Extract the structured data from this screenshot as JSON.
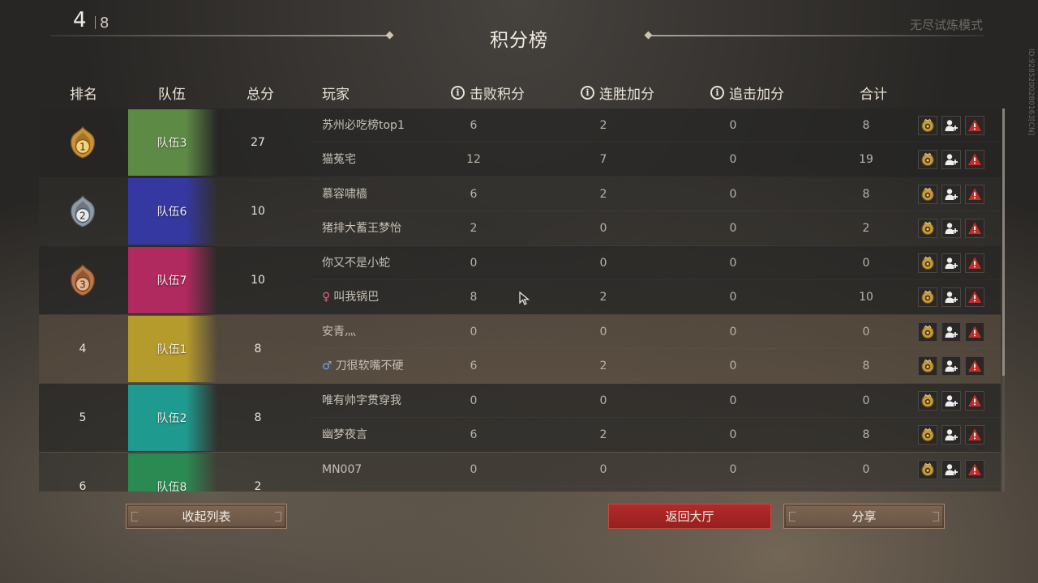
{
  "header": {
    "round_current": "4",
    "round_total": "8",
    "title": "积分榜",
    "mode": "无尽试炼模式",
    "side_id": "ID:9285200280163[CN]"
  },
  "columns": {
    "rank": "排名",
    "team": "队伍",
    "total": "总分",
    "player": "玩家",
    "defeat_points": "击败积分",
    "streak_bonus": "连胜加分",
    "chase_bonus": "追击加分",
    "sum": "合计"
  },
  "teams": [
    {
      "rank": "1",
      "medal": "gold",
      "name": "队伍3",
      "total": "27",
      "color": "#5d8a45",
      "style": "odd",
      "players": [
        {
          "name": "苏州必吃榜top1",
          "gender": "",
          "defeat": "6",
          "streak": "2",
          "chase": "0",
          "sum": "8"
        },
        {
          "name": "猫菟宅",
          "gender": "",
          "defeat": "12",
          "streak": "7",
          "chase": "0",
          "sum": "19"
        }
      ]
    },
    {
      "rank": "2",
      "medal": "silver",
      "name": "队伍6",
      "total": "10",
      "color": "#3538a0",
      "style": "even",
      "players": [
        {
          "name": "慕容啸樯",
          "gender": "",
          "defeat": "6",
          "streak": "2",
          "chase": "0",
          "sum": "8"
        },
        {
          "name": "猪排大蓄王梦怡",
          "gender": "",
          "defeat": "2",
          "streak": "0",
          "chase": "0",
          "sum": "2"
        }
      ]
    },
    {
      "rank": "3",
      "medal": "bronze",
      "name": "队伍7",
      "total": "10",
      "color": "#b0295f",
      "style": "odd",
      "players": [
        {
          "name": "你又不是小蛇",
          "gender": "",
          "defeat": "0",
          "streak": "0",
          "chase": "0",
          "sum": "0"
        },
        {
          "name": "叫我锅巴",
          "gender": "♀",
          "defeat": "8",
          "streak": "2",
          "chase": "0",
          "sum": "10"
        }
      ]
    },
    {
      "rank": "4",
      "medal": "",
      "name": "队伍1",
      "total": "8",
      "color": "#b59a2c",
      "style": "hl",
      "players": [
        {
          "name": "安青灬",
          "gender": "",
          "defeat": "0",
          "streak": "0",
          "chase": "0",
          "sum": "0"
        },
        {
          "name": "刀很软嘴不硬",
          "gender": "♂",
          "defeat": "6",
          "streak": "2",
          "chase": "0",
          "sum": "8"
        }
      ]
    },
    {
      "rank": "5",
      "medal": "",
      "name": "队伍2",
      "total": "8",
      "color": "#1f9a8e",
      "style": "odd",
      "players": [
        {
          "name": "唯有帅字贯穿我",
          "gender": "",
          "defeat": "0",
          "streak": "0",
          "chase": "0",
          "sum": "0"
        },
        {
          "name": "幽梦夜言",
          "gender": "",
          "defeat": "6",
          "streak": "2",
          "chase": "0",
          "sum": "8"
        }
      ]
    },
    {
      "rank": "6",
      "medal": "",
      "name": "队伍8",
      "total": "2",
      "color": "#2a8a52",
      "style": "even",
      "players": [
        {
          "name": "MN007",
          "gender": "",
          "defeat": "0",
          "streak": "0",
          "chase": "0",
          "sum": "0"
        }
      ]
    }
  ],
  "actions": {
    "profile_icon": "badge-icon",
    "add_friend_icon": "add-friend-icon",
    "report_icon": "report-icon"
  },
  "colors": {
    "female": "#e0607a",
    "male": "#6aa8e8",
    "report_red": "#c0302a",
    "badge_gold": "#c89a3a"
  },
  "buttons": {
    "collapse": "收起列表",
    "back": "返回大厅",
    "share": "分享"
  }
}
